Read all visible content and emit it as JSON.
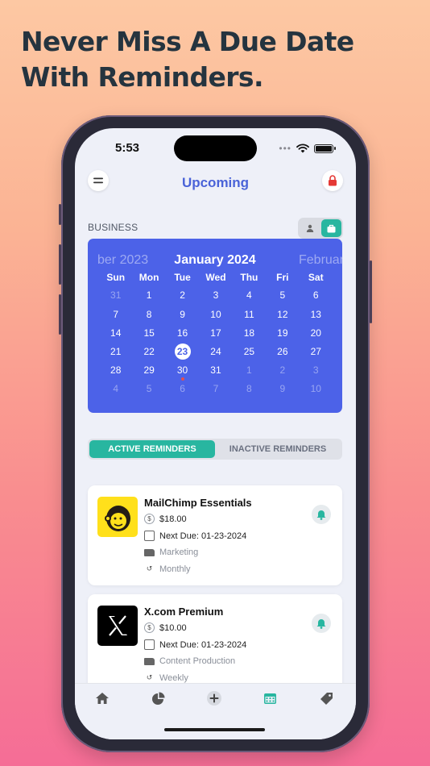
{
  "headline": "Never Miss A Due Date With Reminders.",
  "status_bar": {
    "time": "5:53",
    "dots": "•••"
  },
  "nav": {
    "title": "Upcoming",
    "menu_icon": "menu-icon",
    "lock_icon": "lock-icon"
  },
  "section_label": "BUSINESS",
  "toggle": {
    "options": [
      "person-icon",
      "briefcase-icon"
    ],
    "selected": "briefcase-icon"
  },
  "calendar": {
    "prev_month": "ber 2023",
    "current_month": "January 2024",
    "next_month": "Februar",
    "weekdays": [
      "Sun",
      "Mon",
      "Tue",
      "Wed",
      "Thu",
      "Fri",
      "Sat"
    ],
    "weeks": [
      [
        "31",
        "1",
        "2",
        "3",
        "4",
        "5",
        "6"
      ],
      [
        "7",
        "8",
        "9",
        "10",
        "11",
        "12",
        "13"
      ],
      [
        "14",
        "15",
        "16",
        "17",
        "18",
        "19",
        "20"
      ],
      [
        "21",
        "22",
        "23",
        "24",
        "25",
        "26",
        "27"
      ],
      [
        "28",
        "29",
        "30",
        "31",
        "1",
        "2",
        "3"
      ],
      [
        "4",
        "5",
        "6",
        "7",
        "8",
        "9",
        "10"
      ]
    ],
    "today": "23",
    "due_marker_day": "30",
    "accent_color": "#4c62e8"
  },
  "tabs": {
    "active": "ACTIVE REMINDERS",
    "inactive": "INACTIVE REMINDERS"
  },
  "reminders": [
    {
      "name": "MailChimp Essentials",
      "price": "$18.00",
      "next_due": "Next Due: 01-23-2024",
      "category": "Marketing",
      "frequency": "Monthly",
      "logo_icon": "mailchimp-logo",
      "logo_color": "#ffe01b"
    },
    {
      "name": "X.com Premium",
      "price": "$10.00",
      "next_due": "Next Due: 01-23-2024",
      "category": "Content Production",
      "frequency": "Weekly",
      "logo_icon": "x-logo",
      "logo_color": "#000000"
    }
  ],
  "tabbar": [
    "home-icon",
    "pie-chart-icon",
    "add-icon",
    "calendar-icon",
    "tag-icon"
  ],
  "colors": {
    "teal": "#28b6a0",
    "brand_blue": "#4a63d8",
    "lock_red": "#e53935"
  }
}
